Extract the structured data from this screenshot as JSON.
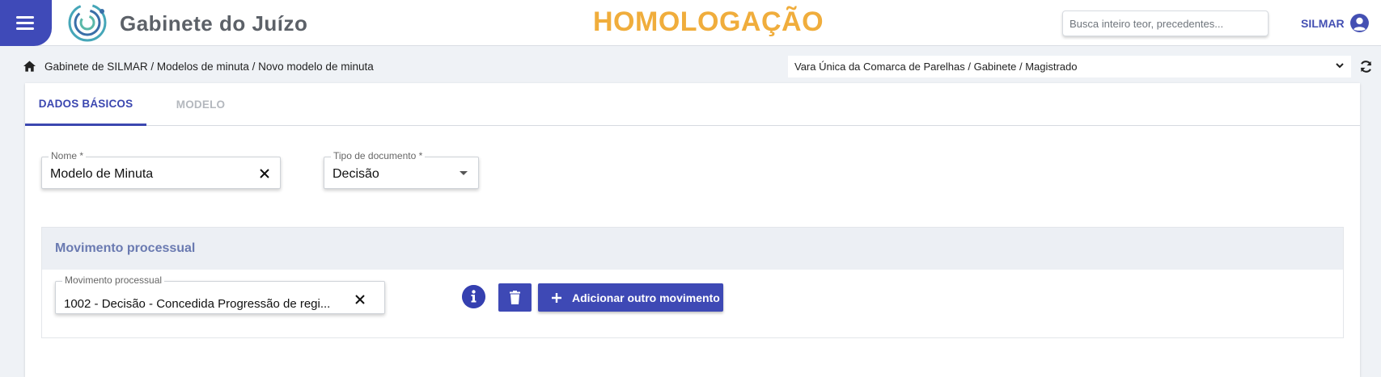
{
  "header": {
    "app_title": "Gabinete do Juízo",
    "environment": "HOMOLOGAÇÃO",
    "search_placeholder": "Busca inteiro teor, precedentes...",
    "user_name": "SILMAR"
  },
  "breadcrumb": {
    "path": "Gabinete de SILMAR / Modelos de minuta / Novo modelo de minuta"
  },
  "unit_select": {
    "selected": "Vara Única da Comarca de Parelhas / Gabinete / Magistrado"
  },
  "tabs": [
    {
      "label": "DADOS BÁSICOS",
      "active": true
    },
    {
      "label": "MODELO",
      "active": false
    }
  ],
  "form": {
    "nome": {
      "label": "Nome *",
      "value": "Modelo de Minuta"
    },
    "tipo_documento": {
      "label": "Tipo de documento *",
      "value": "Decisão"
    }
  },
  "movimento": {
    "section_title": "Movimento processual",
    "field_label": "Movimento processual",
    "field_value": "1002 - Decisão -  Concedida Progressão de regi...",
    "add_button": "Adicionar outro movimento"
  },
  "colors": {
    "primary": "#3e49b5",
    "environment": "#f0ad3c",
    "section_title": "#6a7ab1"
  },
  "icons": [
    "menu-icon",
    "logo-icon",
    "user-circle-icon",
    "home-icon",
    "chevron-down-icon",
    "refresh-icon",
    "close-icon",
    "caret-down-icon",
    "info-icon",
    "trash-icon",
    "plus-icon"
  ]
}
